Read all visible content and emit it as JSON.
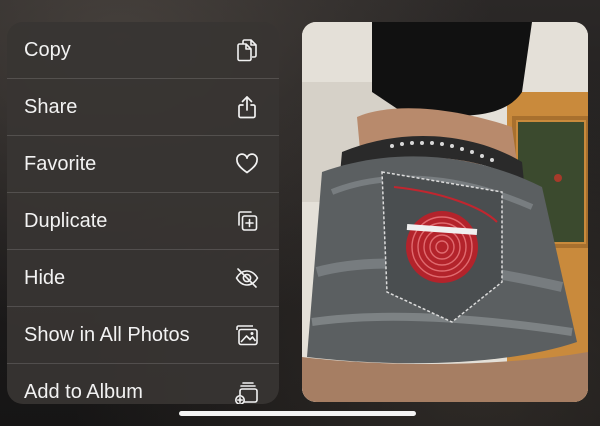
{
  "menu": {
    "items": [
      {
        "label": "Copy",
        "icon": "copy-icon"
      },
      {
        "label": "Share",
        "icon": "share-icon"
      },
      {
        "label": "Favorite",
        "icon": "heart-icon"
      },
      {
        "label": "Duplicate",
        "icon": "duplicate-icon"
      },
      {
        "label": "Hide",
        "icon": "eye-slash-icon"
      },
      {
        "label": "Show in All Photos",
        "icon": "photo-icon"
      },
      {
        "label": "Add to Album",
        "icon": "add-to-album-icon"
      }
    ]
  },
  "photo": {
    "description_icon": "photo-preview"
  },
  "colors": {
    "menu_background": "#383533",
    "text": "#f2f2f2",
    "accent_red": "#c8232c"
  }
}
